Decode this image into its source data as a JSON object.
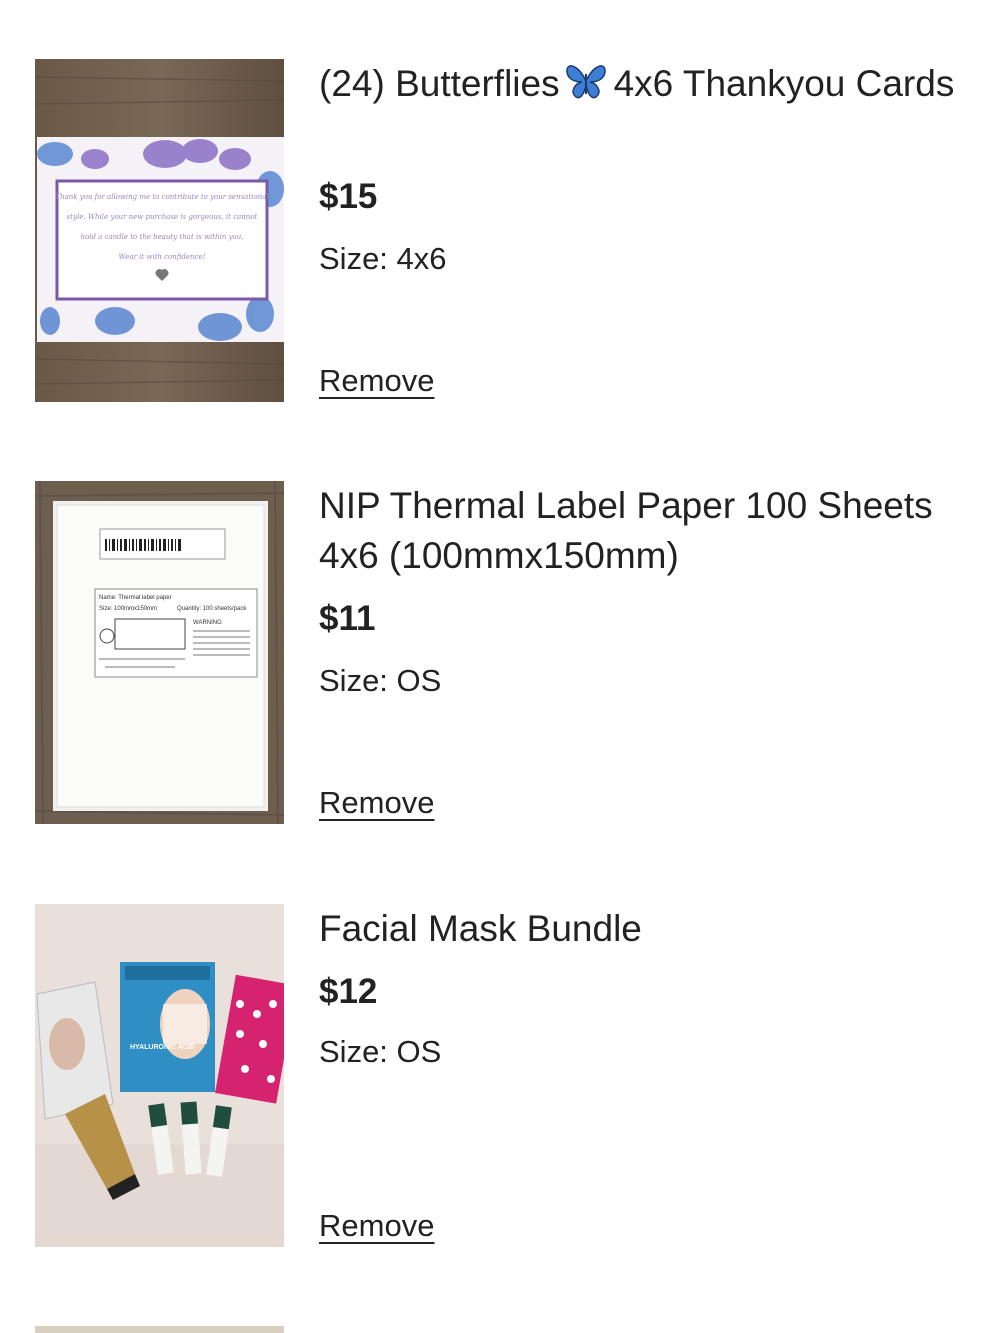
{
  "items": [
    {
      "title_before": "(24) Butterflies",
      "title_icon": "butterfly-emoji",
      "title_after": "4x6 Thankyou Cards",
      "price": "$15",
      "size": "Size: 4x6",
      "remove_label": "Remove",
      "image_text": "Thank you for allowing me to contribute to your sensational style. While your new purchase is gorgeous, it cannot hold a candle to the beauty that is within you. Wear it with confidence!"
    },
    {
      "title": "NIP Thermal Label Paper 100 Sheets 4x6 (100mmx150mm)",
      "price": "$11",
      "size": "Size: OS",
      "remove_label": "Remove",
      "image_label_name": "Name: Thermal label paper",
      "image_label_size": "Size: 100mmx150mm",
      "image_label_qty": "Quantity: 100 sheets/pack",
      "image_label_warning": "WARNING"
    },
    {
      "title": "Facial Mask Bundle",
      "price": "$12",
      "size": "Size: OS",
      "remove_label": "Remove",
      "image_mask_text": "HYALURONIC ACID"
    }
  ],
  "colors": {
    "text": "#222222",
    "butterfly_blue": "#3d7fd6",
    "butterfly_dark": "#1f3a6b"
  }
}
